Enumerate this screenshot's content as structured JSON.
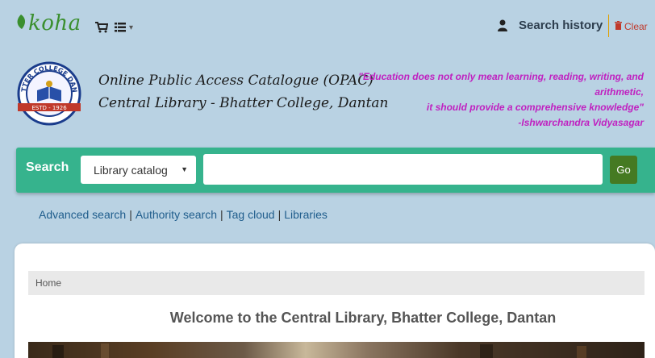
{
  "topbar": {
    "logo_text": "koha",
    "search_history_label": "Search history",
    "clear_label": "Clear"
  },
  "header": {
    "title_line1": "Online Public Access Catalogue (OPAC)",
    "title_line2": "Central Library - Bhatter College, Dantan",
    "quote_line1": "\"Education does not only mean learning, reading, writing, and",
    "quote_line2": "arithmetic,",
    "quote_line3": "it should provide a comprehensive knowledge\"",
    "quote_author": "-Ishwarchandra Vidyasagar",
    "crest": {
      "arc_text": "BHATTER COLLEGE DANTAN",
      "estd_text": "ESTD - 1926"
    }
  },
  "search": {
    "label": "Search",
    "scope_selected": "Library catalog",
    "input_value": "",
    "go_label": "Go"
  },
  "more_searches": {
    "advanced": "Advanced search",
    "authority": "Authority search",
    "tag_cloud": "Tag cloud",
    "libraries": "Libraries"
  },
  "main": {
    "breadcrumb_home": "Home",
    "welcome_heading": "Welcome to the Central Library, Bhatter College, Dantan"
  },
  "colors": {
    "page_bg": "#b9d2e3",
    "koha_green": "#3a8f2e",
    "search_bar": "#36b38d",
    "go_button": "#457a22",
    "quote_magenta": "#c020c0",
    "link_blue": "#1f5d8c"
  },
  "icons": {
    "logo": "koha-leaf-icon",
    "cart": "cart-icon",
    "lists": "list-icon",
    "user": "user-icon",
    "clear": "trash-icon"
  }
}
